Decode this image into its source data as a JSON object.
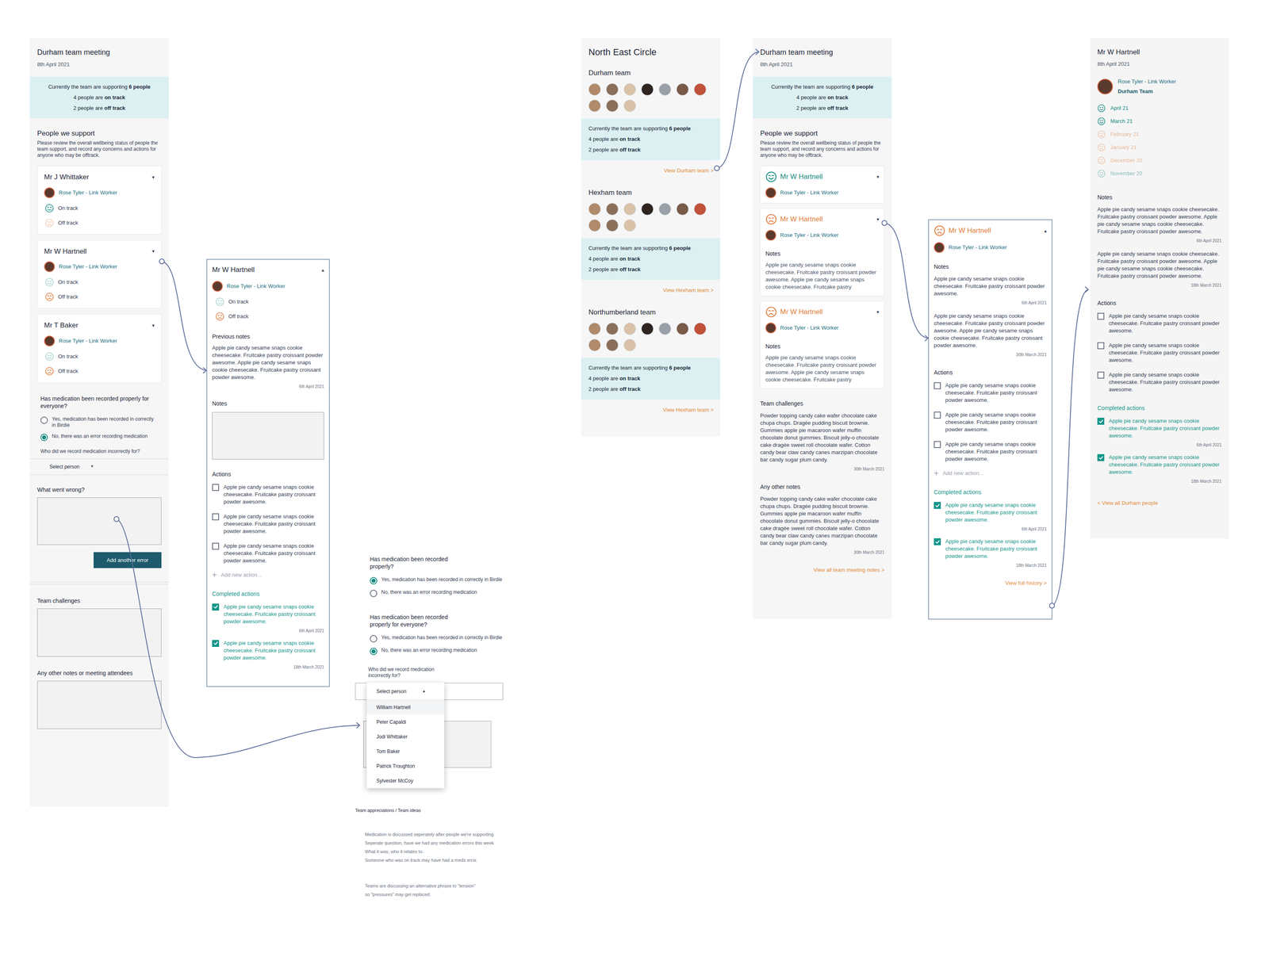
{
  "meetingForm": {
    "title": "Durham team meeting",
    "date": "8th April 2021",
    "summary": [
      {
        "pre": "Currently the team are supporting ",
        "bold": "6 people"
      },
      {
        "pre": "4 people are ",
        "bold": "on track"
      },
      {
        "pre": "2 people are ",
        "bold": "off track"
      }
    ],
    "peopleHeading": "People we support",
    "peopleIntro": "Please review the overall wellbeing status of people the team support, and record any concerns and actions for anyone who may be offtrack.",
    "people": [
      {
        "name": "Mr J Whittaker",
        "toggle": "▾",
        "worker": "Rose Tyler - Link Worker",
        "options": [
          {
            "label": "On track",
            "kind": "on",
            "selected": true
          },
          {
            "label": "Off track",
            "kind": "off",
            "selected": false
          }
        ]
      },
      {
        "name": "Mr W Hartnell",
        "toggle": "▾",
        "worker": "Rose Tyler - Link Worker",
        "options": [
          {
            "label": "On track",
            "kind": "on",
            "selected": false
          },
          {
            "label": "Off track",
            "kind": "off",
            "selected": true
          }
        ]
      },
      {
        "name": "Mr T Baker",
        "toggle": "▾",
        "worker": "Rose Tyler - Link Worker",
        "options": [
          {
            "label": "On track",
            "kind": "on",
            "selected": false
          },
          {
            "label": "Off track",
            "kind": "off",
            "selected": true
          }
        ]
      }
    ],
    "medication": {
      "question": "Has medication been recorded properly for everyone?",
      "options": [
        {
          "label": "Yes, medication has been recorded in correctly in Birdie",
          "selected": false
        },
        {
          "label": "No, there was an error recording medication",
          "selected": true
        }
      ],
      "whoLabel": "Who did we record medication incorrectly for?",
      "select": {
        "placeholder": "Select person",
        "arrow": "▾"
      },
      "wrongLabel": "What went wrong?",
      "addButton": "Add another error"
    },
    "challengesLabel": "Team challenges",
    "notesLabel": "Any other notes or meeting attendees"
  },
  "personCard": {
    "name": "Mr W Hartnell",
    "toggle": "▴",
    "worker": "Rose Tyler - Link Worker",
    "options": [
      {
        "label": "On track",
        "kind": "on",
        "selected": false
      },
      {
        "label": "Off track",
        "kind": "off",
        "selected": true
      }
    ],
    "previousHeading": "Previous notes",
    "previousNote": {
      "text": "Apple pie candy sesame snaps cookie cheesecake. Fruitcake pastry croissant powder awesome. Apple pie candy sesame snaps cookie cheesecake. Fruitcake pastry croissant powder awesome.",
      "date": "6th April 2021"
    },
    "notesLabel": "Notes",
    "actionsHeading": "Actions",
    "actions": [
      {
        "text": "Apple pie candy sesame snaps cookie cheesecake. Fruitcake pastry croissant powder awesome.",
        "checked": false
      },
      {
        "text": "Apple pie candy sesame snaps cookie cheesecake. Fruitcake pastry croissant powder awesome.",
        "checked": false
      },
      {
        "text": "Apple pie candy sesame snaps cookie cheesecake. Fruitcake pastry croissant powder awesome.",
        "checked": false
      }
    ],
    "addIcon": "+",
    "addAction": "Add new action...",
    "completedHeading": "Completed actions",
    "completed": [
      {
        "text": "Apple pie candy sesame snaps cookie cheesecake. Fruitcake pastry croissant powder awesome.",
        "checked": true,
        "date": "6th April 2021"
      },
      {
        "text": "Apple pie candy sesame snaps cookie cheesecake. Fruitcake pastry croissant powder awesome.",
        "checked": true,
        "date": "18th March 2021"
      }
    ]
  },
  "medicationOptions": {
    "q1": {
      "question": "Has medication been recorded properly?",
      "options": [
        {
          "label": "Yes, medication has been recorded in correctly in Birdie",
          "selected": true
        },
        {
          "label": "No, there was an error recording medication",
          "selected": false
        }
      ]
    },
    "q2": {
      "question": "Has medication been recorded properly for everyone?",
      "options": [
        {
          "label": "Yes, medication has been recorded in correctly in Birdie",
          "selected": false
        },
        {
          "label": "No, there was an error recording medication",
          "selected": true
        }
      ]
    },
    "whoLabel": "Who did we record medication incorrectly for?",
    "select": {
      "placeholder": "Select person",
      "arrow": "▴",
      "expanded": true,
      "options": [
        {
          "label": "William Hartnell",
          "selected": true
        },
        {
          "label": "Peter Capaldi",
          "selected": false
        },
        {
          "label": "Jodi Whittaker",
          "selected": false
        },
        {
          "label": "Tom Baker",
          "selected": false
        },
        {
          "label": "Patrick Troughton",
          "selected": false
        },
        {
          "label": "Sylvester McCoy",
          "selected": false
        }
      ]
    },
    "appreciations": "Team appreciations / Team ideas",
    "comments": [
      [
        "Medication is discussed seperately after people we're supporting",
        "Seperate question, have we had any medication errors this week",
        "What it was, who it relates to.",
        "Someone who was on track may have had a meds error."
      ],
      [
        "Teams are discussing an alternative phrase to \"tension\"",
        "so \"pressures\" may get replaced."
      ]
    ]
  },
  "circle": {
    "title": "North East Circle",
    "teams": [
      {
        "name": "Durham team",
        "avatars": 10,
        "summary": [
          {
            "pre": "Currently the team are supporting ",
            "bold": "6 people"
          },
          {
            "pre": "4 people are ",
            "bold": "on track"
          },
          {
            "pre": "2 people are ",
            "bold": "off track"
          }
        ],
        "link": "View Durham team >"
      },
      {
        "name": "Hexham team",
        "avatars": 10,
        "summary": [
          {
            "pre": "Currently the team are supporting ",
            "bold": "6 people"
          },
          {
            "pre": "4 people are ",
            "bold": "on track"
          },
          {
            "pre": "2 people are ",
            "bold": "off track"
          }
        ],
        "link": "View Hexham team >"
      },
      {
        "name": "Northumberland team",
        "avatars": 10,
        "summary": [
          {
            "pre": "Currently the team are supporting ",
            "bold": "6 people"
          },
          {
            "pre": "4 people are ",
            "bold": "on track"
          },
          {
            "pre": "2 people are ",
            "bold": "off track"
          }
        ],
        "link": "View Hexham team >"
      }
    ]
  },
  "meetingView": {
    "title": "Durham team meeting",
    "date": "8th April 2021",
    "summary": [
      {
        "pre": "Currently the team are supporting ",
        "bold": "6 people"
      },
      {
        "pre": "4 people are ",
        "bold": "on track"
      },
      {
        "pre": "2 people are ",
        "bold": "off track"
      }
    ],
    "peopleHeading": "People we support",
    "peopleIntro": "Please review the overall wellbeing status of people the team support, and record any concerns and actions for anyone who may be offtrack.",
    "people": [
      {
        "name": "Mr W Hartnell",
        "kind": "on",
        "toggle": "▾",
        "worker": "Rose Tyler - Link Worker"
      },
      {
        "name": "Mr W Hartnell",
        "kind": "off",
        "toggle": "▾",
        "worker": "Rose Tyler - Link Worker",
        "notesLabel": "Notes",
        "notes": "Apple pie candy sesame snaps cookie cheesecake. Fruitcake pastry croissant powder awesome. Apple pie candy sesame snaps cookie cheesecake. Fruitcake pastry"
      },
      {
        "name": "Mr W Hartnell",
        "kind": "off",
        "toggle": "▾",
        "worker": "Rose Tyler - Link Worker",
        "notesLabel": "Notes",
        "notes": "Apple pie candy sesame snaps cookie cheesecake. Fruitcake pastry croissant powder awesome. Apple pie candy sesame snaps cookie cheesecake. Fruitcake pastry"
      }
    ],
    "challenges": {
      "label": "Team challenges",
      "text": "Powder topping candy cake wafer chocolate cake chupa chups. Dragée pudding biscuit brownie. Gummies apple pie macaroon wafer muffin chocolate donut gummies. Biscuit jelly-o chocolate cake dragée sweet roll chocolate wafer. Cotton candy bear claw candy canes marzipan chocolate bar candy sugar plum candy.",
      "date": "30th March 2021"
    },
    "otherNotes": {
      "label": "Any other notes",
      "text": "Powder topping candy cake wafer chocolate cake chupa chups. Dragée pudding biscuit brownie. Gummies apple pie macaroon wafer muffin chocolate donut gummies. Biscuit jelly-o chocolate cake dragée sweet roll chocolate wafer. Cotton candy bear claw candy canes marzipan chocolate bar candy sugar plum candy.",
      "date": "30th March 2021"
    },
    "link": "View all team meeting notes >"
  },
  "personDetail": {
    "name": "Mr W Hartnell",
    "kind": "off",
    "toggle": "▴",
    "worker": "Rose Tyler - Link Worker",
    "notesLabel": "Notes",
    "notes": [
      {
        "text": "Apple pie candy sesame snaps cookie cheesecake. Fruitcake pastry croissant powder awesome.",
        "date": "6th April 2021"
      },
      {
        "text": "Apple pie candy sesame snaps cookie cheesecake. Fruitcake pastry croissant powder awesome. Apple pie candy sesame snaps cookie cheesecake. Fruitcake pastry croissant powder awesome.",
        "date": "30th March 2021"
      }
    ],
    "actionsHeading": "Actions",
    "actions": [
      {
        "text": "Apple pie candy sesame snaps cookie cheesecake. Fruitcake pastry croissant powder awesome.",
        "checked": false
      },
      {
        "text": "Apple pie candy sesame snaps cookie cheesecake. Fruitcake pastry croissant powder awesome.",
        "checked": false
      },
      {
        "text": "Apple pie candy sesame snaps cookie cheesecake. Fruitcake pastry croissant powder awesome.",
        "checked": false
      }
    ],
    "addIcon": "+",
    "addAction": "Add new action...",
    "completedHeading": "Completed actions",
    "completed": [
      {
        "text": "Apple pie candy sesame snaps cookie cheesecake. Fruitcake pastry croissant powder awesome.",
        "checked": true,
        "date": "6th April 2021"
      },
      {
        "text": "Apple pie candy sesame snaps cookie cheesecake. Fruitcake pastry croissant powder awesome.",
        "checked": true,
        "date": "18th March 2021"
      }
    ],
    "link": "View full history >"
  },
  "history": {
    "name": "Mr W Hartnell",
    "date": "8th April 2021",
    "worker": "Rose Tyler - Link Worker",
    "team": "Durham Team",
    "months": [
      {
        "label": "April 21",
        "kind": "on",
        "current": true
      },
      {
        "label": "March 21",
        "kind": "on",
        "current": true
      },
      {
        "label": "February 21",
        "kind": "off",
        "current": false
      },
      {
        "label": "January 21",
        "kind": "off",
        "current": false
      },
      {
        "label": "December 20",
        "kind": "off",
        "current": false
      },
      {
        "label": "November 20",
        "kind": "on",
        "current": false
      }
    ],
    "notesLabel": "Notes",
    "notes": [
      {
        "text": "Apple pie candy sesame snaps cookie cheesecake. Fruitcake pastry croissant powder awesome. Apple pie candy sesame snaps cookie cheesecake. Fruitcake pastry croissant powder awesome.",
        "date": "6th April 2021"
      },
      {
        "text": "Apple pie candy sesame snaps cookie cheesecake. Fruitcake pastry croissant powder awesome. Apple pie candy sesame snaps cookie cheesecake. Fruitcake pastry croissant powder awesome.",
        "date": "18th March 2021"
      }
    ],
    "actionsHeading": "Actions",
    "actions": [
      {
        "text": "Apple pie candy sesame snaps cookie cheesecake. Fruitcake pastry croissant powder awesome.",
        "checked": false
      },
      {
        "text": "Apple pie candy sesame snaps cookie cheesecake. Fruitcake pastry croissant powder awesome.",
        "checked": false
      },
      {
        "text": "Apple pie candy sesame snaps cookie cheesecake. Fruitcake pastry croissant powder awesome.",
        "checked": false
      }
    ],
    "completedHeading": "Completed actions",
    "completed": [
      {
        "text": "Apple pie candy sesame snaps cookie cheesecake. Fruitcake pastry croissant powder awesome.",
        "checked": true,
        "date": "6th April 2021"
      },
      {
        "text": "Apple pie candy sesame snaps cookie cheesecake. Fruitcake pastry croissant powder awesome.",
        "checked": true,
        "date": "18th March 2021"
      }
    ],
    "backLink": "< View all Durham people"
  }
}
